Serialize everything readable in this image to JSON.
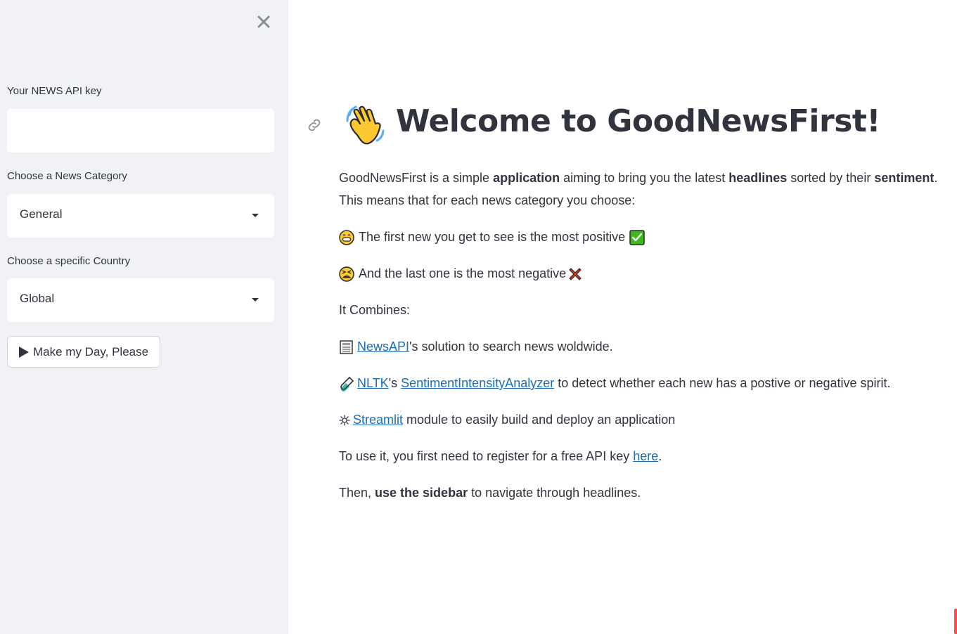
{
  "colors": {
    "sidebar_bg": "#f0f2f6",
    "text": "#31333f",
    "link": "#1c6cb7",
    "accent": "#ff4b4b"
  },
  "sidebar": {
    "close_icon": "close-icon",
    "api_key": {
      "label": "Your NEWS API key",
      "value": ""
    },
    "category": {
      "label": "Choose a News Category",
      "selected": "General"
    },
    "country": {
      "label": "Choose a specific Country",
      "selected": "Global"
    },
    "run_button": {
      "label": "Make my Day, Please",
      "icon": "play-icon"
    }
  },
  "main": {
    "anchor_icon": "link-icon",
    "title_icon": "waving-hand-icon",
    "title": "Welcome to GoodNewsFirst!",
    "intro": {
      "t1": "GoodNewsFirst is a simple ",
      "b1": "application",
      "t2": " aiming to bring you the latest ",
      "b2": "headlines",
      "t3": " sorted by their ",
      "b3": "sentiment",
      "t4": ".",
      "line2": "This means that for each news category you choose:"
    },
    "positive_line": {
      "icon": "grinning-face-icon",
      "text": "The first new you get to see is the most positive",
      "end_icon": "check-mark-icon"
    },
    "negative_line": {
      "icon": "tired-face-icon",
      "text": "And the last one is the most negative",
      "end_icon": "cross-mark-icon"
    },
    "combines": "It Combines:",
    "newsapi_line": {
      "icon": "newspaper-icon",
      "link": "NewsAPI",
      "text": "'s solution to search news woldwide."
    },
    "nltk_line": {
      "icon": "test-tube-icon",
      "link1": "NLTK",
      "mid": "'s ",
      "link2": "SentimentIntensityAnalyzer",
      "text": " to detect whether each new has a postive or negative spirit."
    },
    "streamlit_line": {
      "icon": "gear-icon",
      "link": "Streamlit",
      "text": " module to easily build and deploy an application"
    },
    "register_line": {
      "text": "To use it, you first need to register for a free API key ",
      "link": "here",
      "end": "."
    },
    "sidebar_line": {
      "t1": "Then, ",
      "b1": "use the sidebar",
      "t2": " to navigate through headlines."
    }
  }
}
